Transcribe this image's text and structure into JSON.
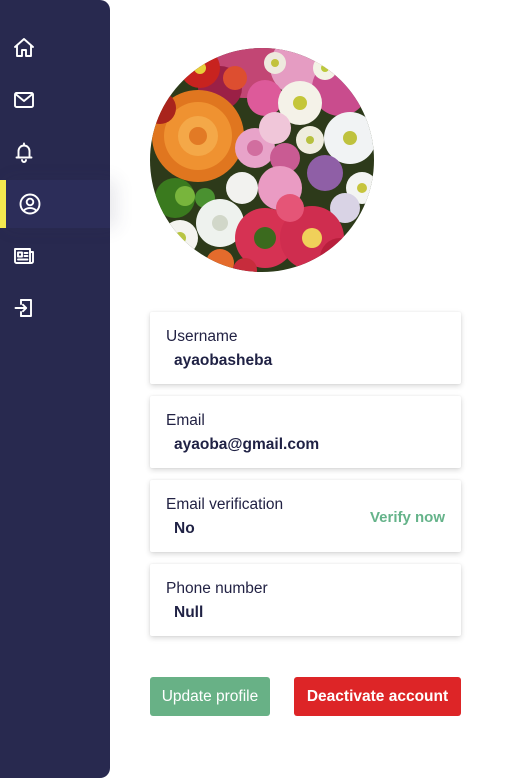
{
  "sidebar": {
    "items": [
      {
        "icon": "home-icon",
        "active": false
      },
      {
        "icon": "mail-icon",
        "active": false
      },
      {
        "icon": "bell-icon",
        "active": false
      },
      {
        "icon": "user-circle-icon",
        "active": true
      },
      {
        "icon": "newspaper-icon",
        "active": false
      },
      {
        "icon": "logout-icon",
        "active": false
      }
    ],
    "accent": "#f4e94f",
    "background": "#28294f"
  },
  "profile": {
    "avatar": "flower-photo",
    "fields": [
      {
        "label": "Username",
        "value": "ayaobasheba"
      },
      {
        "label": "Email",
        "value": "ayaoba@gmail.com"
      },
      {
        "label": "Email verification",
        "value": "No",
        "action": "Verify now"
      },
      {
        "label": "Phone number",
        "value": "Null"
      }
    ]
  },
  "actions": {
    "update_label": "Update profile",
    "deactivate_label": "Deactivate account",
    "update_color": "#68b186",
    "deactivate_color": "#dd2527"
  }
}
